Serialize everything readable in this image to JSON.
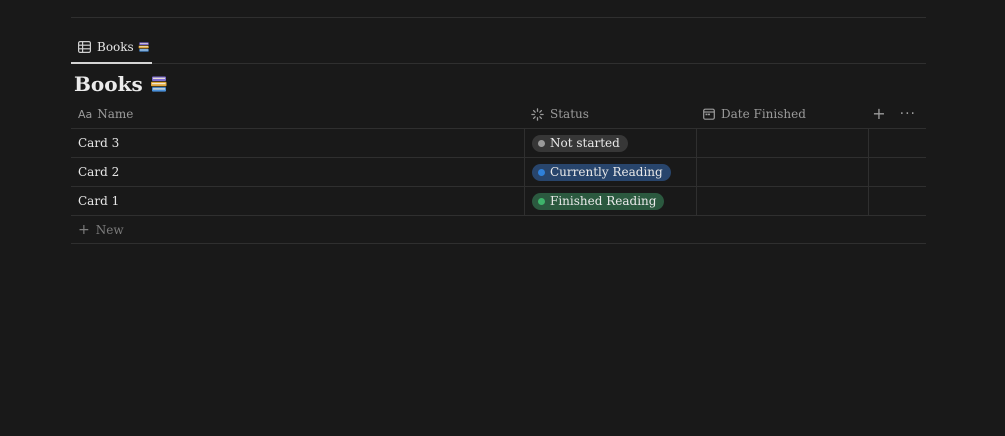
{
  "view_tab": {
    "label": "Books",
    "emoji": "📚"
  },
  "database": {
    "title": "Books"
  },
  "columns": {
    "name": {
      "type_glyph": "Aa",
      "label": "Name"
    },
    "status": {
      "label": "Status"
    },
    "date": {
      "label": "Date Finished"
    }
  },
  "rows": [
    {
      "name": "Card 3",
      "status": "Not started",
      "status_color": "#9b9b9b",
      "pill_bg": "#373737"
    },
    {
      "name": "Card 2",
      "status": "Currently Reading",
      "status_color": "#2f80d9",
      "pill_bg": "#28456c"
    },
    {
      "name": "Card 1",
      "status": "Finished Reading",
      "status_color": "#3eb46b",
      "pill_bg": "#2b593f"
    }
  ],
  "new_row": {
    "label": "New"
  },
  "icons": {
    "table": "table-icon",
    "status": "status-spinner-icon",
    "date": "calendar-icon",
    "add_column": "plus-icon",
    "more": "more-icon"
  }
}
